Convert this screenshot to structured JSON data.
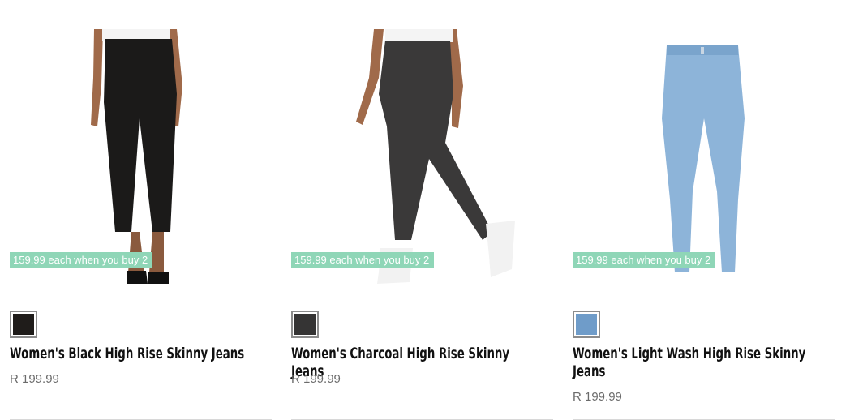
{
  "products": [
    {
      "promo": "159.99 each when you buy 2",
      "swatch_color": "#1f1c1a",
      "swatch_icon": "black-swatch",
      "title": "Women's Black High Rise Skinny Jeans",
      "price": "R 199.99",
      "jean_color": "#1b1a19"
    },
    {
      "promo": "159.99 each when you buy 2",
      "swatch_color": "#353434",
      "swatch_icon": "charcoal-swatch",
      "title": "Women's Charcoal High Rise Skinny Jeans",
      "price": "R 199.99",
      "jean_color": "#3a3939"
    },
    {
      "promo": "159.99 each when you buy 2",
      "swatch_color": "#6f9cc9",
      "swatch_icon": "light-wash-swatch",
      "title": "Women's Light Wash High Rise Skinny Jeans",
      "price": "R 199.99",
      "jean_color": "#8db4d9"
    }
  ]
}
